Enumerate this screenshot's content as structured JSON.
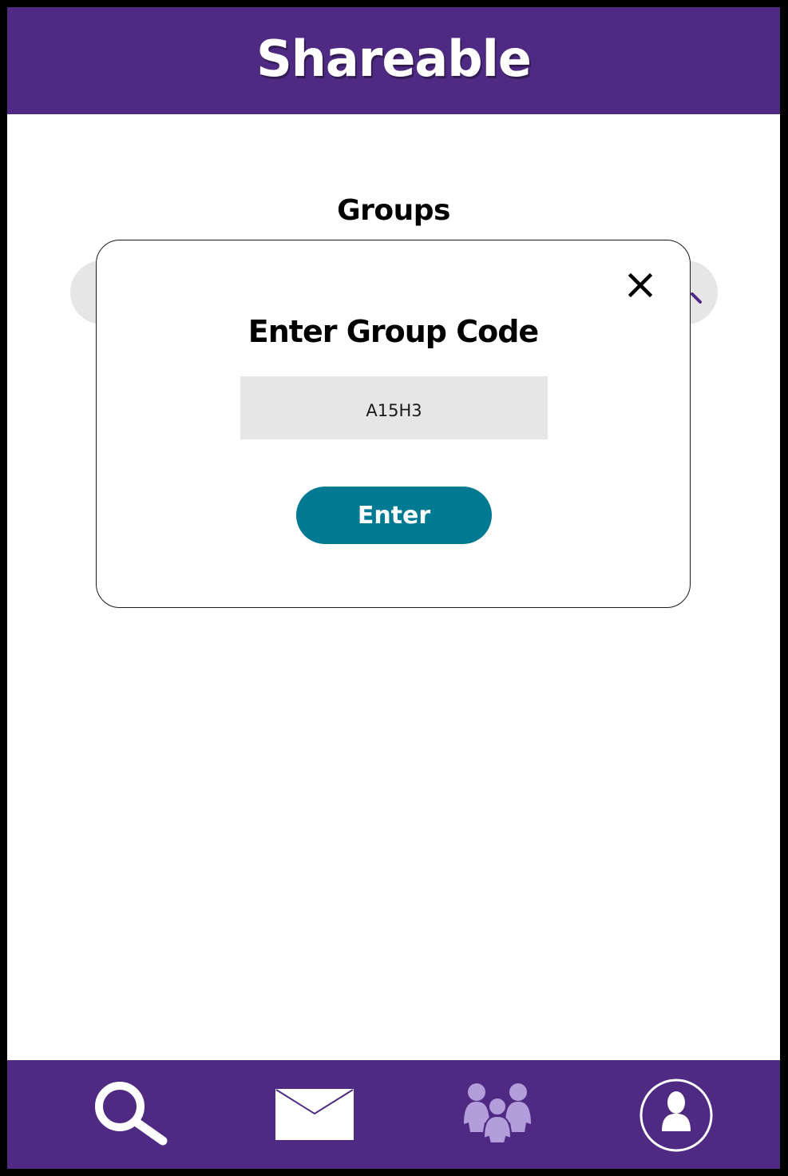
{
  "app": {
    "title": "Shareable"
  },
  "page": {
    "title": "Groups"
  },
  "modal": {
    "title": "Enter Group Code",
    "code_value": "A15H3",
    "enter_label": "Enter",
    "close_icon": "close-icon"
  },
  "nav": {
    "items": [
      {
        "name": "search",
        "icon": "search-icon"
      },
      {
        "name": "messages",
        "icon": "mail-icon"
      },
      {
        "name": "groups",
        "icon": "people-group-icon",
        "active": true
      },
      {
        "name": "profile",
        "icon": "user-profile-icon"
      }
    ]
  },
  "colors": {
    "primary": "#4f2a83",
    "accent": "#007a93",
    "input_bg": "#e6e6e6",
    "active_nav_icon": "#b39ddb"
  }
}
